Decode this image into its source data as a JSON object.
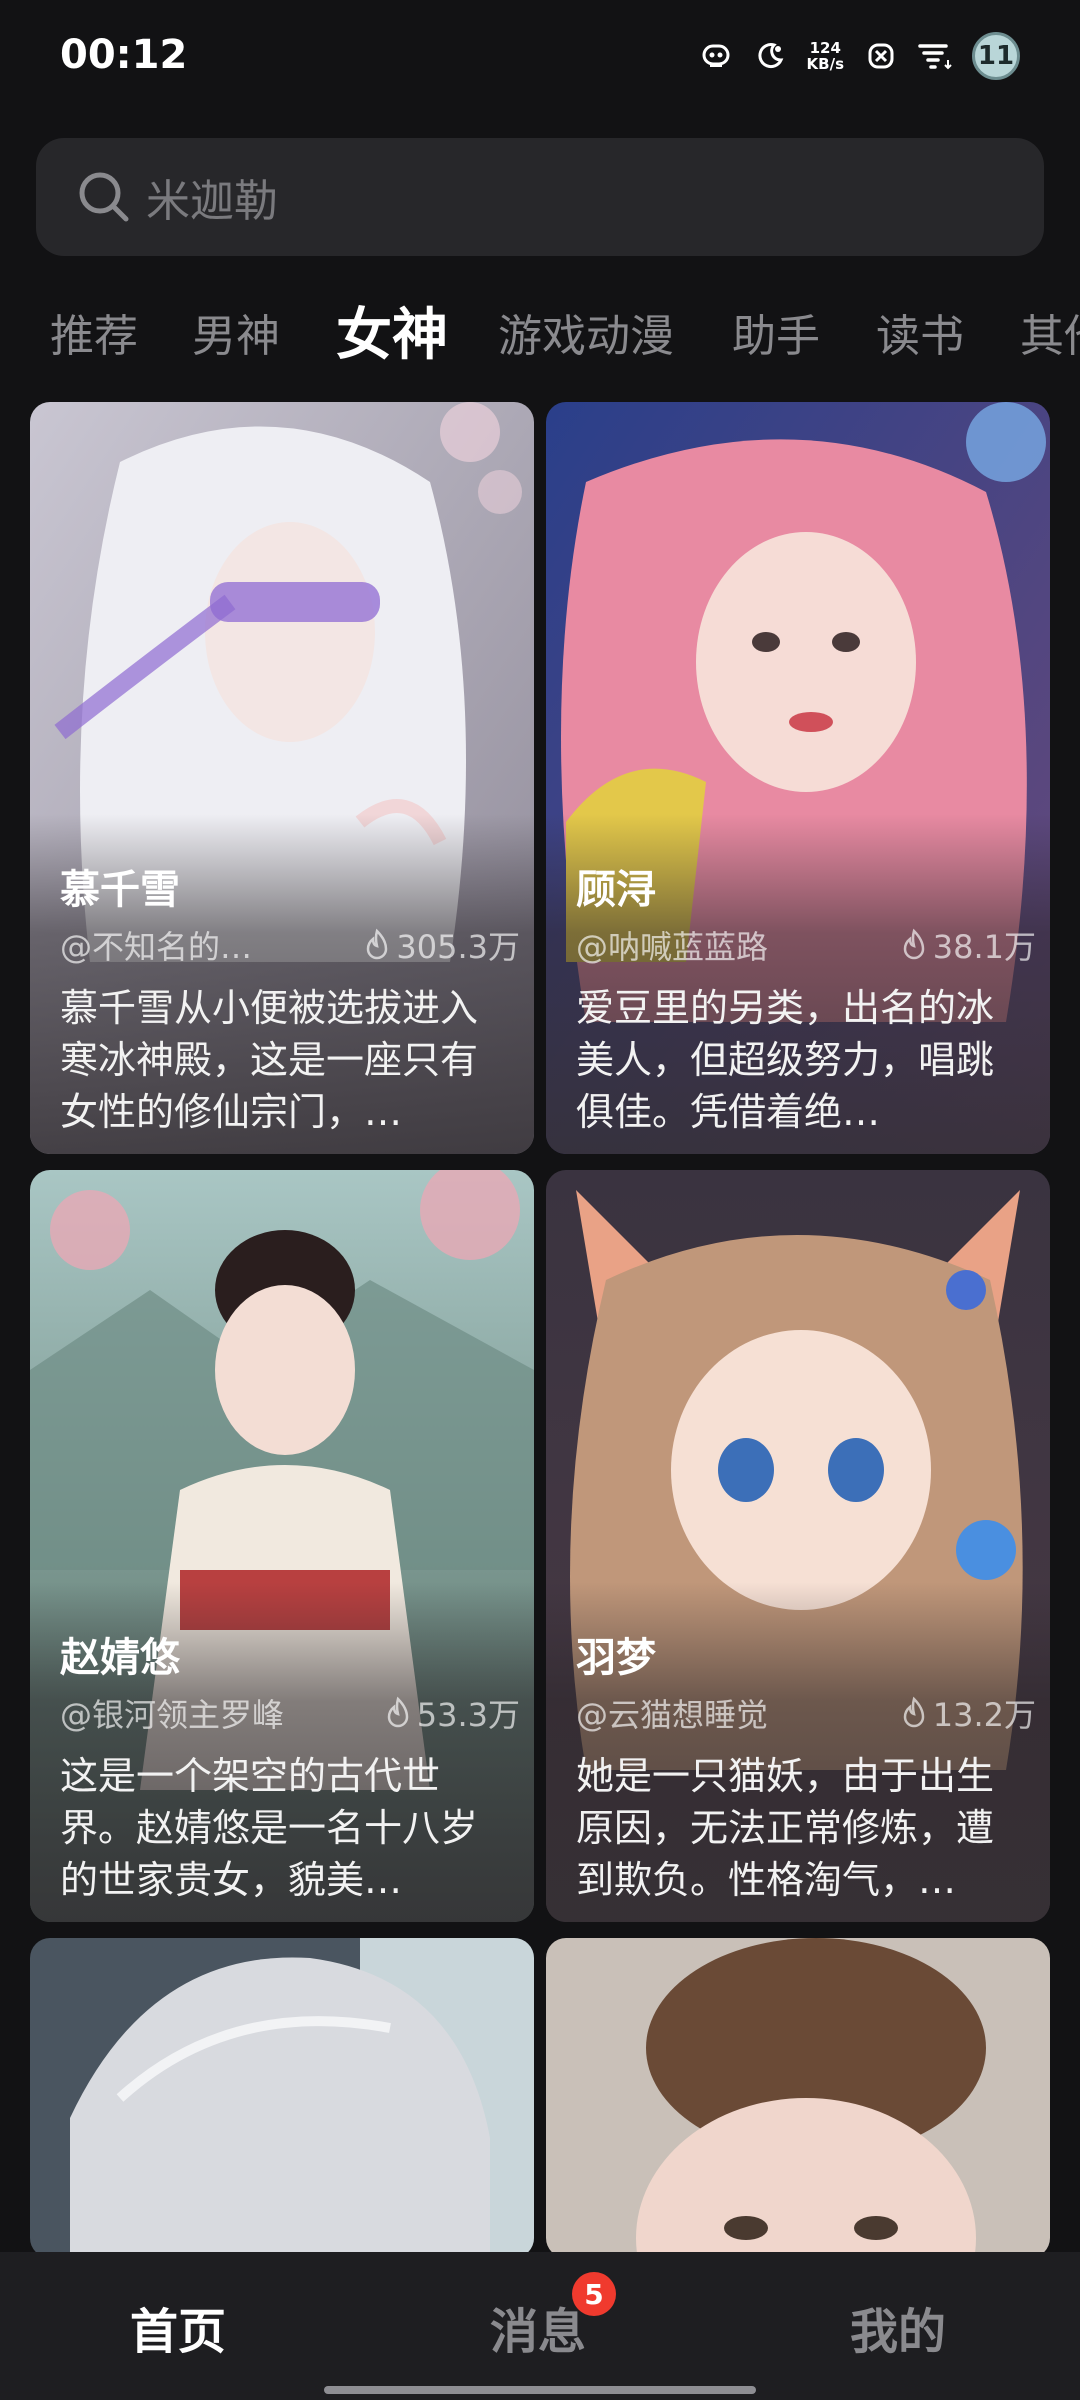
{
  "status": {
    "time": "00:12",
    "net_speed_value": "124",
    "net_speed_unit": "KB/s",
    "battery": "11"
  },
  "search": {
    "placeholder": "米迦勒"
  },
  "tabs": [
    {
      "label": "推荐"
    },
    {
      "label": "男神"
    },
    {
      "label": "女神",
      "active": true
    },
    {
      "label": "游戏动漫"
    },
    {
      "label": "助手"
    },
    {
      "label": "读书"
    },
    {
      "label": "其他"
    }
  ],
  "cards": [
    {
      "name": "慕千雪",
      "author": "@不知名的…",
      "hot": "305.3万",
      "desc": "慕千雪从小便被选拔进入寒冰神殿，这是一座只有女性的修仙宗门，…"
    },
    {
      "name": "顾浔",
      "author": "@呐喊蓝蓝路",
      "hot": "38.1万",
      "desc": "爱豆里的另类，出名的冰美人，但超级努力，唱跳俱佳。凭借着绝…"
    },
    {
      "name": "赵婧悠",
      "author": "@银河领主罗峰",
      "hot": "53.3万",
      "desc": "这是一个架空的古代世界。赵婧悠是一名十八岁的世家贵女，貌美…"
    },
    {
      "name": "羽梦",
      "author": "@云猫想睡觉",
      "hot": "13.2万",
      "desc": "她是一只猫妖，由于出生原因，无法正常修炼，遭到欺负。性格淘气，…"
    }
  ],
  "bottom_nav": {
    "home": "首页",
    "messages": "消息",
    "messages_badge": "5",
    "me": "我的"
  },
  "colors": {
    "background": "#121214",
    "search_bg": "#27272a",
    "tab_inactive": "#8a8a8e",
    "badge": "#f03a2e"
  }
}
